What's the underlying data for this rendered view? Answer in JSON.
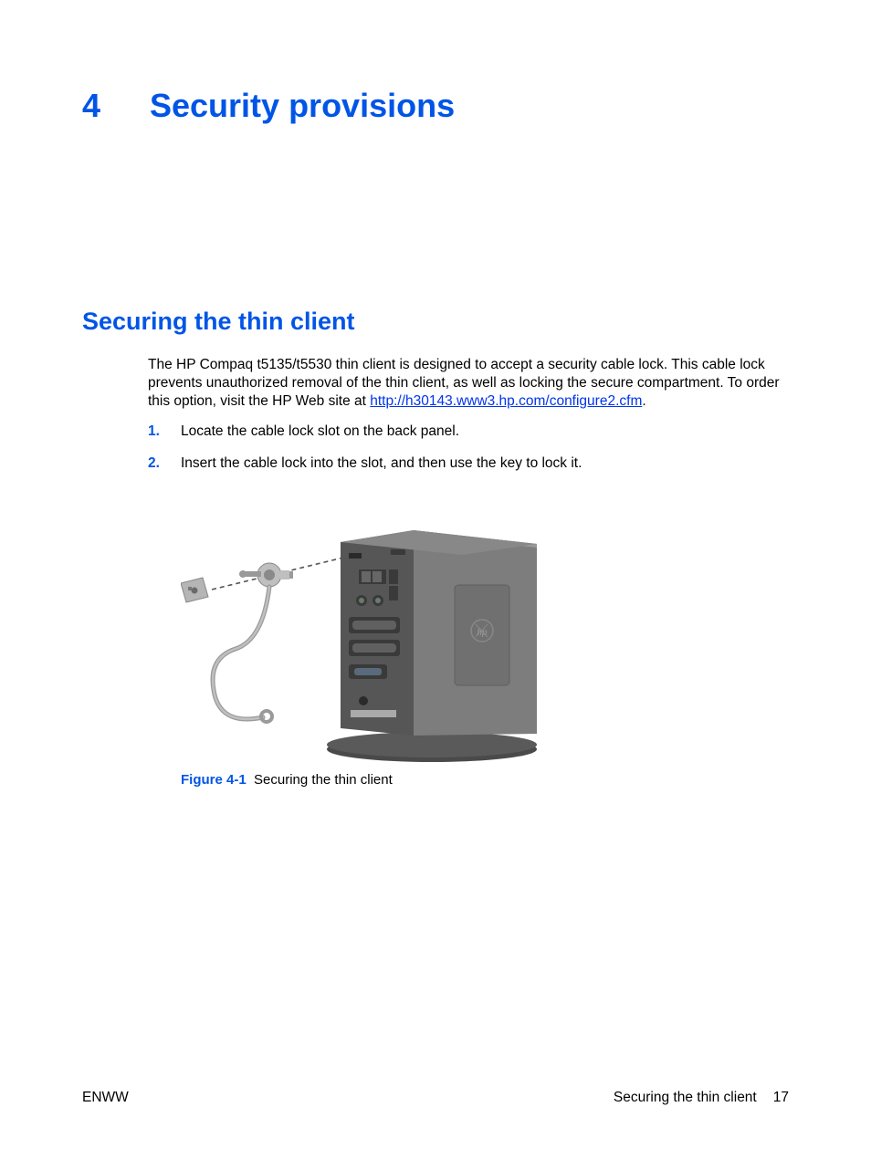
{
  "chapter": {
    "number": "4",
    "title": "Security provisions"
  },
  "section": {
    "title": "Securing the thin client"
  },
  "paragraph": {
    "part1": "The HP Compaq t5135/t5530 thin client is designed to accept a security cable lock. This cable lock prevents unauthorized removal of the thin client, as well as locking the secure compartment. To order this option, visit the HP Web site at ",
    "link_text": "http://h30143.www3.hp.com/configure2.cfm",
    "part2": "."
  },
  "steps": [
    {
      "num": "1.",
      "text": "Locate the cable lock slot on the back panel."
    },
    {
      "num": "2.",
      "text": "Insert the cable lock into the slot, and then use the key to lock it."
    }
  ],
  "figure": {
    "label": "Figure 4-1",
    "caption": "Securing the thin client"
  },
  "footer": {
    "left": "ENWW",
    "right_text": "Securing the thin client",
    "page": "17"
  }
}
